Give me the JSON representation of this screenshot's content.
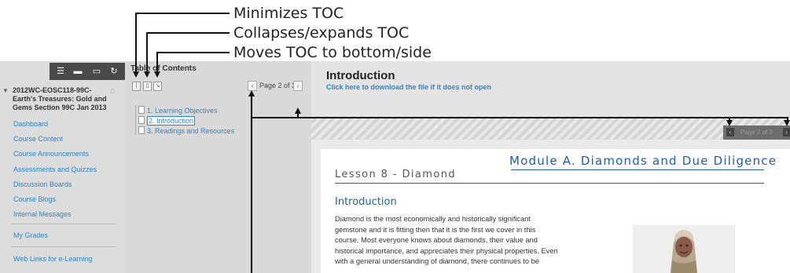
{
  "callouts": {
    "minimize": "Minimizes TOC",
    "collapse": "Collapses/expands TOC",
    "move": "Moves TOC to bottom/side"
  },
  "course_menu": {
    "course_title": "2012WC-EOSC118-99C-Earth's Treasures: Gold and Gems Section 99C Jan 2013",
    "items": [
      {
        "label": "Dashboard"
      },
      {
        "label": "Course Content"
      },
      {
        "label": "Course Announcements"
      },
      {
        "label": "Assessments and Quizzes"
      },
      {
        "label": "Discussion Boards"
      },
      {
        "label": "Course Blogs"
      },
      {
        "label": "Internal Messages"
      },
      {
        "label": "My Grades"
      },
      {
        "label": "Web Links for e-Learning"
      }
    ]
  },
  "toc": {
    "title": "Table of Contents",
    "page_label": "Page 2 of 3",
    "items": [
      {
        "label": "1. Learning Objectives"
      },
      {
        "label": "2. Introduction"
      },
      {
        "label": "3. Readings and Resources"
      }
    ]
  },
  "content": {
    "title": "Introduction",
    "download_link": "Click here to download the file if it does not open",
    "viewer_page": "Page 2 of 3"
  },
  "document": {
    "module_title": "Module A. Diamonds and Due Diligence",
    "lesson_title": "Lesson 8 - Diamond",
    "heading": "Introduction",
    "lines": [
      "Diamond is the most economically and historically significant",
      "gemstone and it is fitting then that it is the first we cover in this",
      "course. Most everyone knows about diamonds, their value and",
      "historical importance, and appreciates their physical properties. Even",
      "with a general understanding of diamond, there continues to be"
    ]
  },
  "colors": {
    "link": "#2d86c4",
    "module_blue": "#1d5ea8",
    "toolbar": "#4a4a4a"
  }
}
